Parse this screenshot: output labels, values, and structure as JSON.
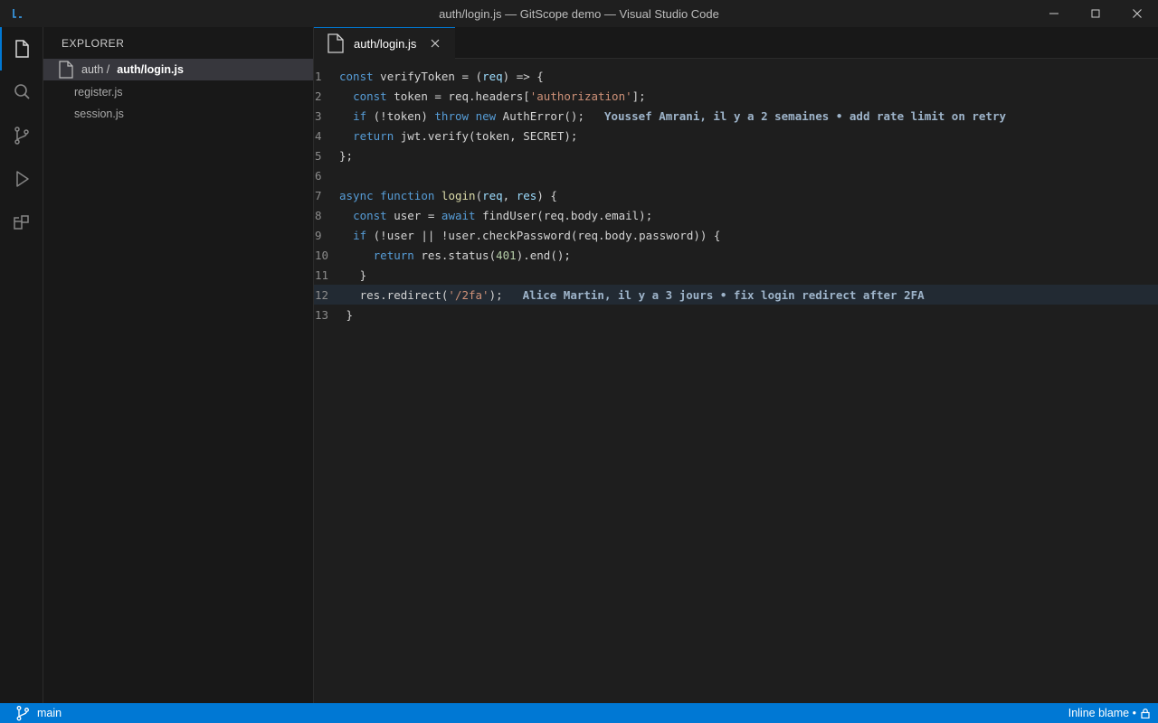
{
  "window": {
    "title": "auth/login.js — GitScope demo — Visual Studio Code"
  },
  "activity_bar": {
    "items": [
      "explorer-icon",
      "search-icon",
      "source-control-icon",
      "run-debug-icon",
      "extensions-icon"
    ],
    "active": "explorer"
  },
  "sidebar": {
    "title": "EXPLORER",
    "selected_folder_prefix": "auth /",
    "selected_file": "auth/login.js",
    "files": [
      "register.js",
      "session.js"
    ]
  },
  "tab": {
    "label": "auth/login.js",
    "close": "×"
  },
  "editor": {
    "line_numbers": [
      "1",
      "2",
      "3",
      "4",
      "5",
      "6",
      "7",
      "8",
      "9",
      "10",
      "11",
      "12",
      "13"
    ],
    "lines": {
      "l1": {
        "kw1": "const",
        "a": " verifyToken = (",
        "var": "req",
        "b": ") => {"
      },
      "l2": {
        "indent": "  ",
        "kw1": "const",
        "a": " token = req.headers[",
        "str": "'authorization'",
        "b": "];"
      },
      "l3": {
        "indent": "  ",
        "kw1": "if",
        "a": " (!token) ",
        "kw2": "throw",
        "sp": " ",
        "kw3": "new",
        "b": " AuthError();",
        "blame": "Youssef Amrani, il y a 2 semaines • add rate limit on retry"
      },
      "l4": {
        "indent": "  ",
        "kw1": "return",
        "a": " jwt.verify(token, SECRET);"
      },
      "l5": {
        "a": "};"
      },
      "l6": {
        "a": ""
      },
      "l7": {
        "kw1": "async",
        "sp": " ",
        "kw2": "function",
        "sp2": " ",
        "fn": "login",
        "a": "(",
        "var1": "req",
        "b": ", ",
        "var2": "res",
        "c": ") {"
      },
      "l8": {
        "indent": "  ",
        "kw1": "const",
        "a": " user = ",
        "kw2": "await",
        "b": " findUser(req.body.email);"
      },
      "l9": {
        "indent": "  ",
        "kw1": "if",
        "a": " (!user || !user.checkPassword(req.body.password)) {"
      },
      "l10": {
        "indent": "     ",
        "kw1": "return",
        "a": " res.status(",
        "num": "401",
        "b": ").end();"
      },
      "l11": {
        "indent": "   ",
        "a": "}"
      },
      "l12": {
        "indent": "   ",
        "a": "res.redirect(",
        "str": "'/2fa'",
        "b": ");",
        "blame": "Alice Martin, il y a 3 jours • fix login redirect after 2FA"
      },
      "l13": {
        "indent": " ",
        "a": "}"
      }
    }
  },
  "status_bar": {
    "branch": "main",
    "right_label": "Inline blame •"
  },
  "colors": {
    "accent": "#0078d4",
    "keyword": "#569cd6",
    "string": "#ce9178",
    "number": "#b5cea8",
    "blame": "#9eb4ca"
  }
}
